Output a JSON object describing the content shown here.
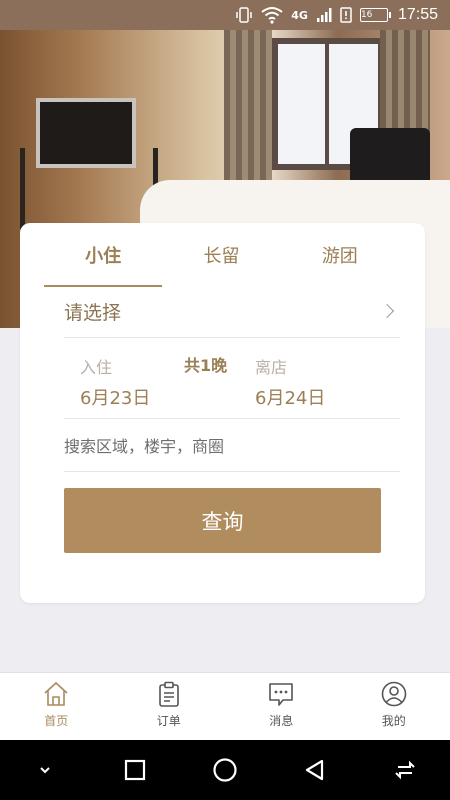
{
  "status_bar": {
    "network": "4G",
    "battery": "16",
    "time": "17:55"
  },
  "tabs": [
    {
      "label": "小住",
      "active": true
    },
    {
      "label": "长留",
      "active": false
    },
    {
      "label": "游团",
      "active": false
    }
  ],
  "select": {
    "label": "请选择"
  },
  "dates": {
    "checkin_label": "入住",
    "checkin_value": "6月23日",
    "nights": "共1晚",
    "checkout_label": "离店",
    "checkout_value": "6月24日"
  },
  "search": {
    "placeholder": "搜索区域，楼宇，商圈"
  },
  "query_button": {
    "label": "查询"
  },
  "bottom_nav": [
    {
      "label": "首页",
      "icon": "home-icon",
      "active": true
    },
    {
      "label": "订单",
      "icon": "clipboard-icon",
      "active": false
    },
    {
      "label": "消息",
      "icon": "message-icon",
      "active": false
    },
    {
      "label": "我的",
      "icon": "profile-icon",
      "active": false
    }
  ],
  "colors": {
    "accent": "#b08c5e",
    "accent_text": "#9c7f55"
  }
}
